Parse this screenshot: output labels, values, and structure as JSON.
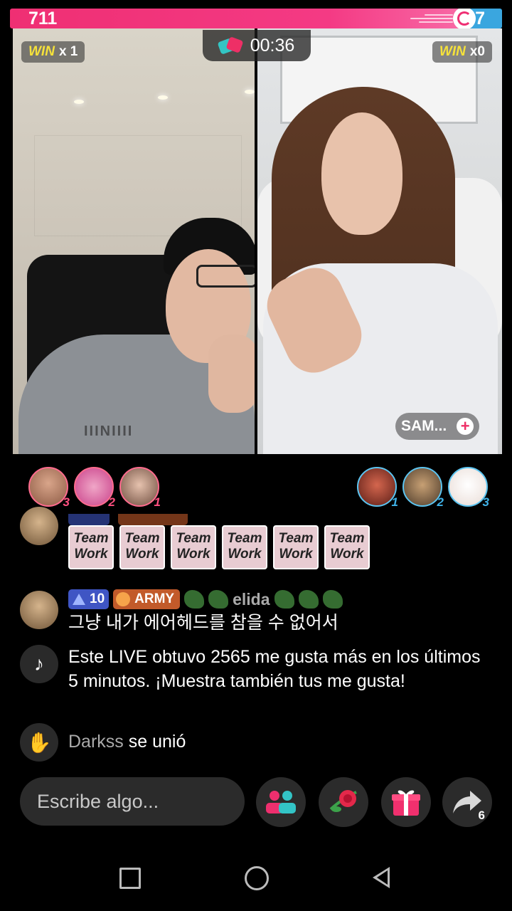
{
  "battle": {
    "left_score": "711",
    "right_score": "57",
    "left_score_fraction": 0.926,
    "timer": "00:36",
    "left_win_label": "WIN",
    "left_win_count": "x 1",
    "right_win_label": "WIN",
    "right_win_count": "x0",
    "left_color": "#ef2f73",
    "right_color": "#3aa6df"
  },
  "right_host": {
    "name": "SAM...",
    "follow_icon": "plus-icon"
  },
  "left_supporters": [
    {
      "rank": "3"
    },
    {
      "rank": "2"
    },
    {
      "rank": "1"
    }
  ],
  "right_supporters": [
    {
      "rank": "1"
    },
    {
      "rank": "2"
    },
    {
      "rank": "3"
    }
  ],
  "chat": {
    "sticker_label": "Team Work",
    "sticker_count": 6,
    "message": {
      "level": "10",
      "fan_badge": "ARMY",
      "username": "elida",
      "text": "그냥 내가 에어헤드를 참을 수 없어서"
    },
    "system_message": {
      "icon": "tiktok-icon",
      "text": "Este LIVE obtuvo 2565 me gusta más en los últimos 5 minutos. ¡Muestra también tus me gusta!"
    },
    "join": {
      "icon": "wave-hand-icon",
      "username": "Darkss",
      "action": "se unió"
    }
  },
  "bottom_bar": {
    "input_placeholder": "Escribe algo...",
    "share_count": "6"
  }
}
